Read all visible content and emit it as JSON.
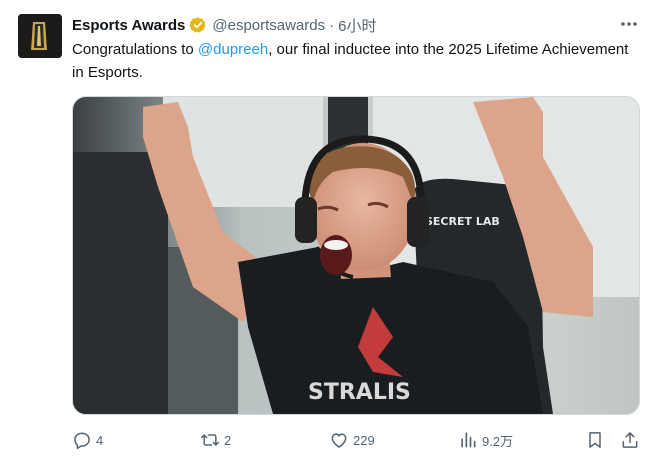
{
  "tweet": {
    "author_name": "Esports Awards",
    "handle": "@esportsawards",
    "separator": "·",
    "time": "6小时",
    "text_before": "Congratulations to ",
    "mention": "@dupreeh",
    "text_after": ", our final inductee into the 2025 Lifetime Achievement in Esports.",
    "media": {
      "chair_brand": "SECRET LAB",
      "jersey_text": "STRALIS"
    },
    "actions": {
      "replies": "4",
      "retweets": "2",
      "likes": "229",
      "views": "9.2万"
    }
  },
  "colors": {
    "text": "#0f1419",
    "secondary": "#536471",
    "link": "#1d9bf0",
    "verified": "#e2b719"
  },
  "icons": [
    "avatar-trophy-icon",
    "verified-badge-icon",
    "more-icon",
    "reply-icon",
    "retweet-icon",
    "like-icon",
    "views-icon",
    "bookmark-icon",
    "share-icon"
  ]
}
